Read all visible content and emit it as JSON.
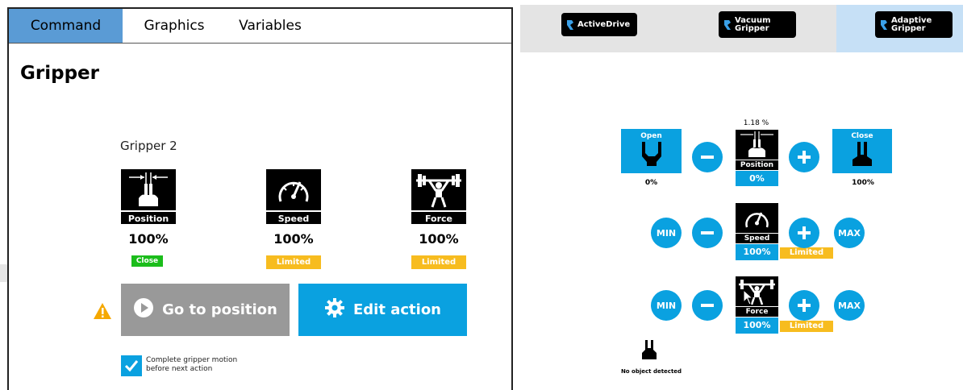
{
  "left": {
    "tabs": [
      {
        "label": "Command",
        "active": true
      },
      {
        "label": "Graphics",
        "active": false
      },
      {
        "label": "Variables",
        "active": false
      }
    ],
    "title": "Gripper",
    "gripper_name": "Gripper 2",
    "gauges": [
      {
        "label": "Position",
        "value": "100%",
        "status": "Close",
        "status_color": "#1bbd1b",
        "icon": "position-icon"
      },
      {
        "label": "Speed",
        "value": "100%",
        "status": "Limited",
        "status_color": "#f7bc1f",
        "icon": "speedometer-icon"
      },
      {
        "label": "Force",
        "value": "100%",
        "status": "Limited",
        "status_color": "#f7bc1f",
        "icon": "weightlifter-icon"
      }
    ],
    "go_button": "Go to position",
    "edit_button": "Edit action",
    "checkbox_checked": true,
    "checkbox_label_line1": "Complete gripper motion",
    "checkbox_label_line2": "before next action"
  },
  "right": {
    "gripper_tabs": [
      {
        "line1": "ActiveDrive",
        "line2": "",
        "selected": false
      },
      {
        "line1": "Vacuum",
        "line2": "Gripper",
        "selected": false
      },
      {
        "line1": "Adaptive",
        "line2": "Gripper",
        "selected": true
      }
    ],
    "position": {
      "open_label": "Open",
      "close_label": "Close",
      "open_value": "0%",
      "close_value": "100%",
      "current_readout": "1.18 %",
      "label": "Position",
      "value": "0%"
    },
    "speed": {
      "min_label": "MIN",
      "max_label": "MAX",
      "label": "Speed",
      "value": "100%",
      "status": "Limited"
    },
    "force": {
      "min_label": "MIN",
      "max_label": "MAX",
      "label": "Force",
      "value": "100%",
      "status": "Limited"
    },
    "object_status": "No object detected"
  },
  "colors": {
    "accent": "#0aa1e0",
    "tab_active": "#5a9bd5",
    "limited": "#f7bc1f",
    "close": "#1bbd1b",
    "disabled": "#999999"
  }
}
